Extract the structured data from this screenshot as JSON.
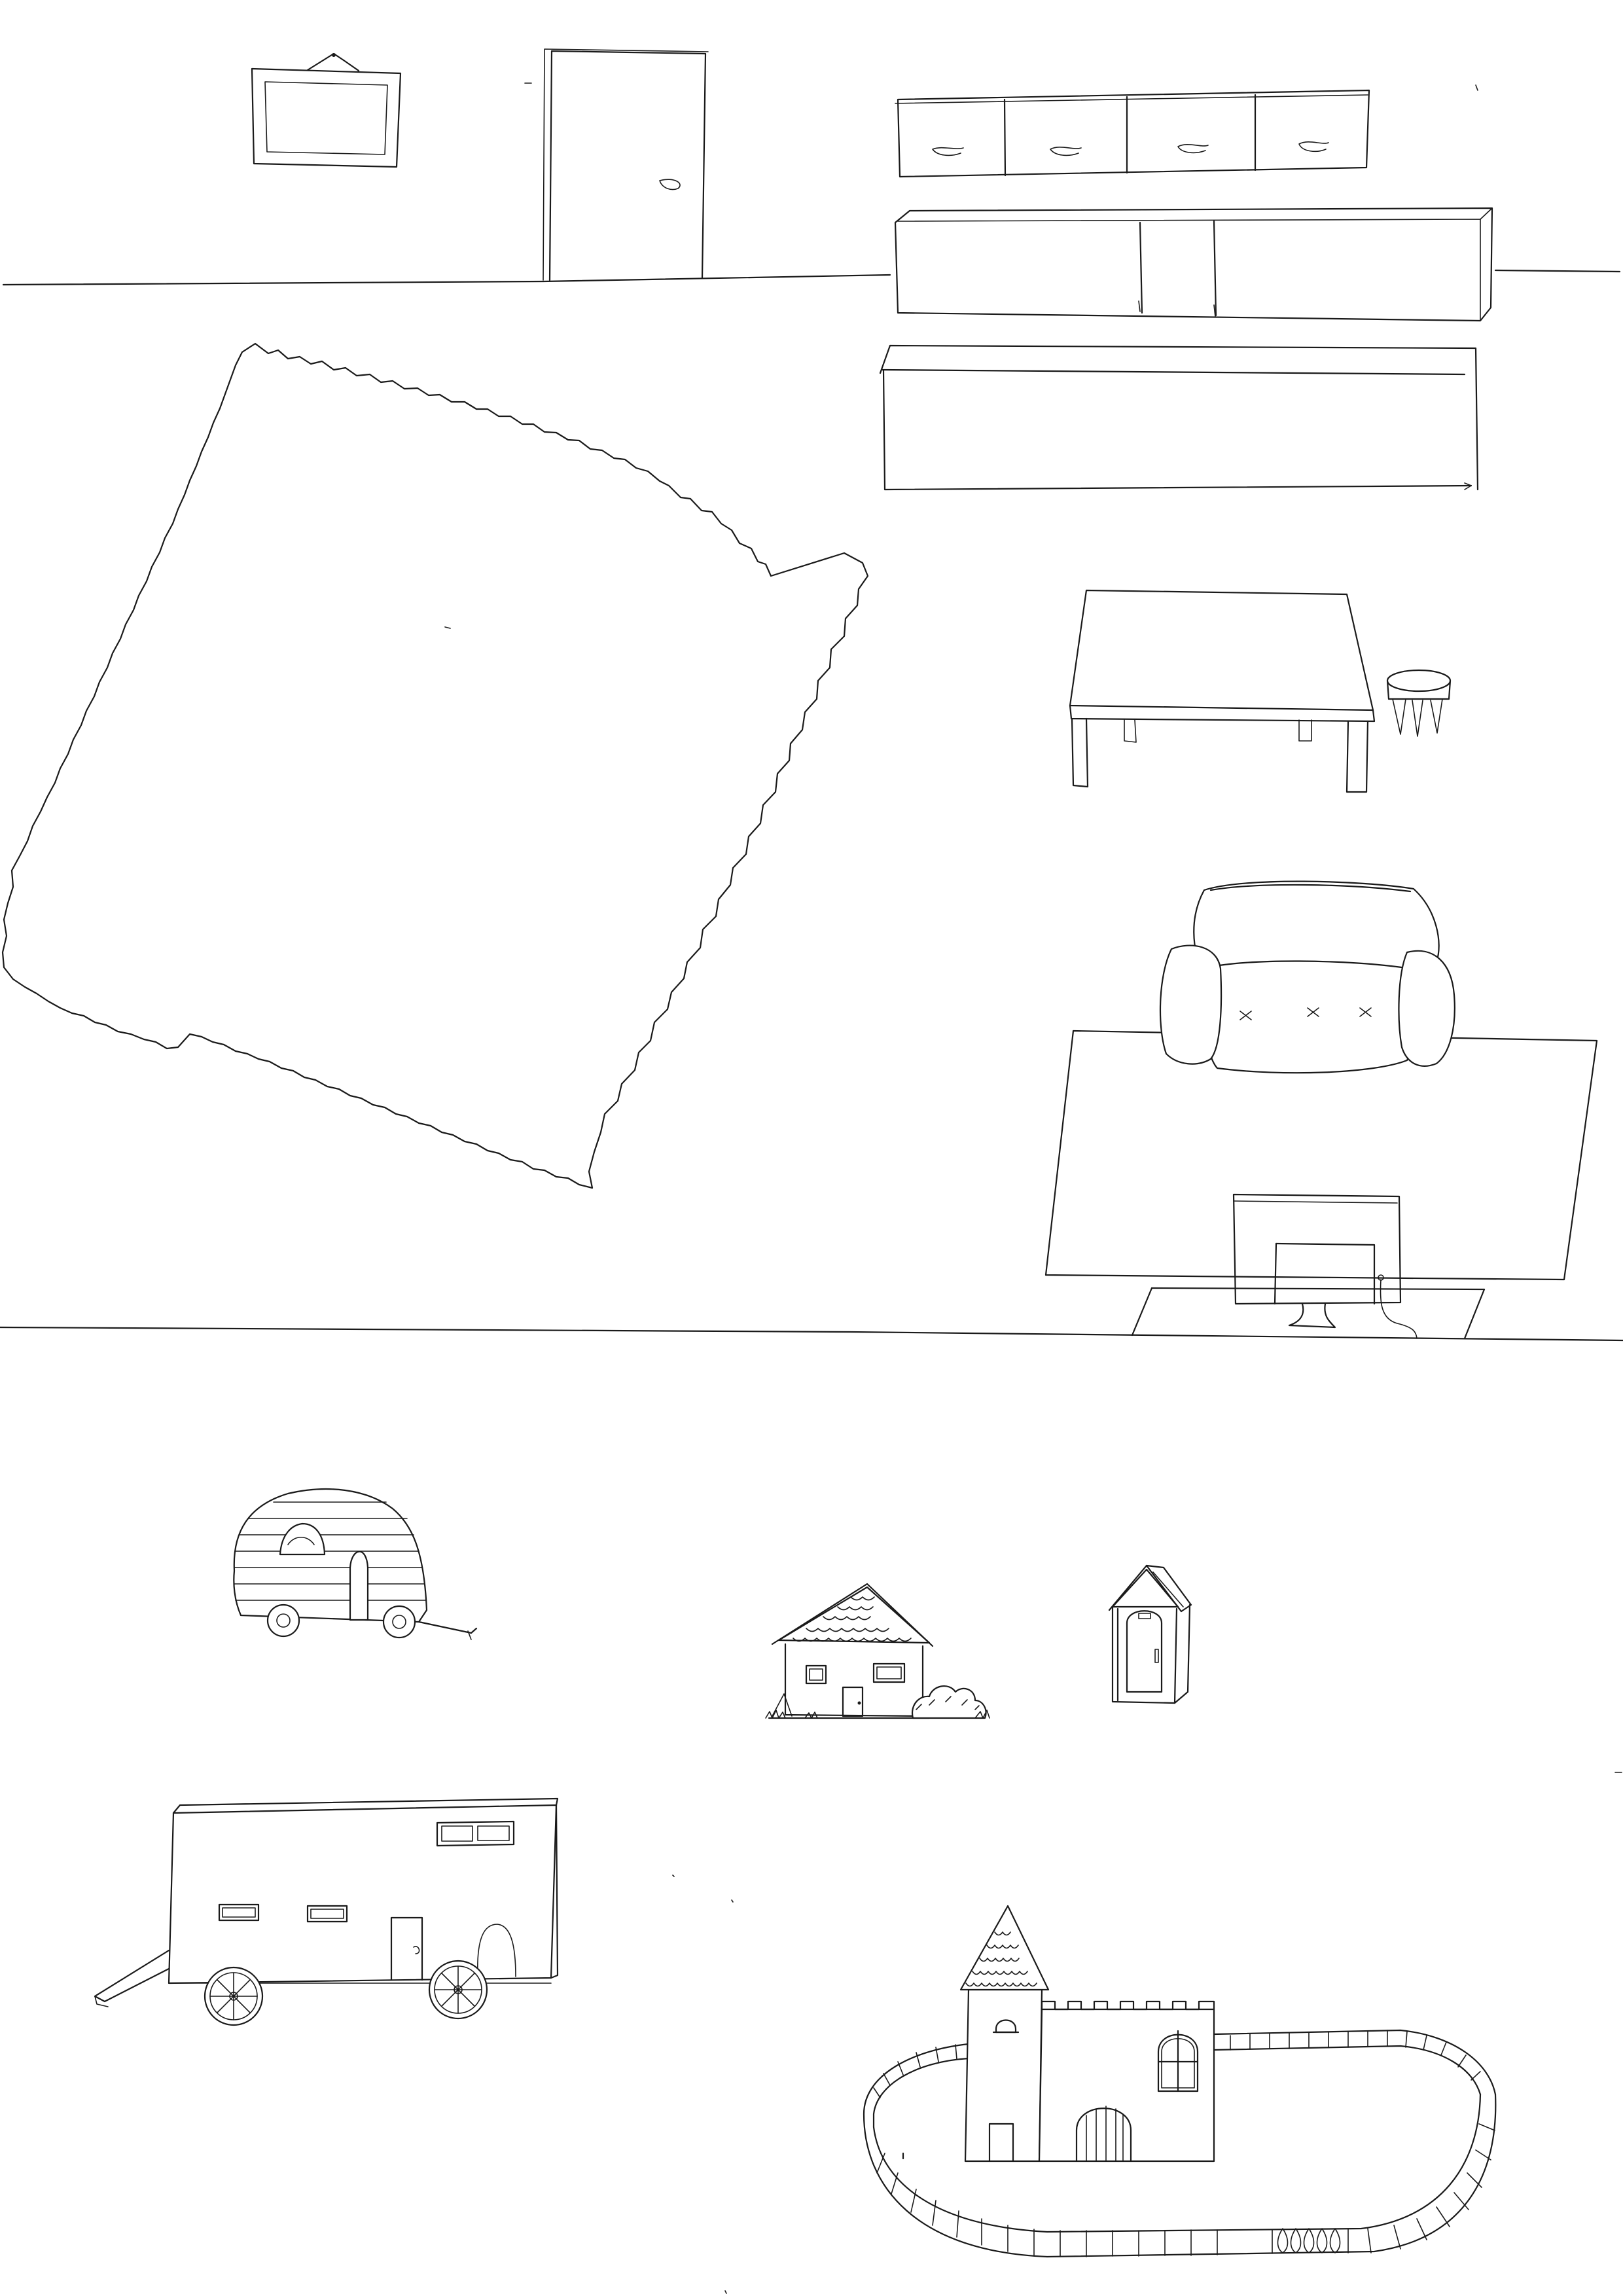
{
  "page": {
    "background": "#ffffff",
    "ink": "#1a1a1a"
  },
  "sketches": {
    "room": {
      "items": [
        "wall-picture",
        "door",
        "wall-cabinets",
        "sideboard",
        "low-cabinet",
        "wavy-rug",
        "table",
        "stool",
        "armchair",
        "floor-rug",
        "tv"
      ]
    },
    "vehicles_and_buildings": {
      "items": [
        "teardrop-caravan",
        "small-house",
        "sentry-box",
        "wagon-trailer",
        "castle-with-fence"
      ]
    }
  }
}
